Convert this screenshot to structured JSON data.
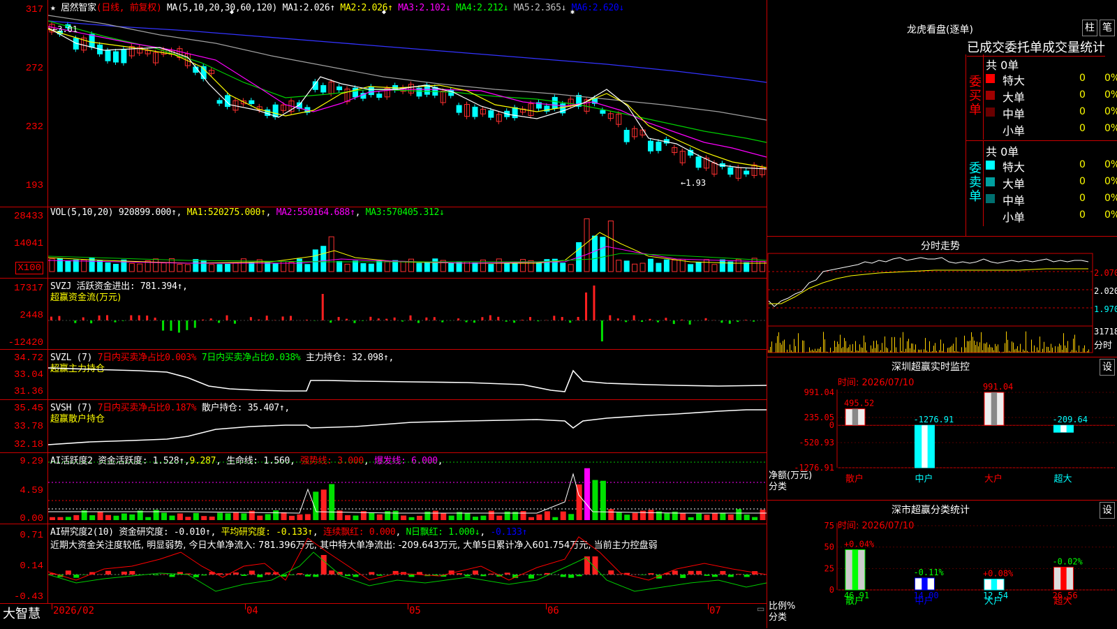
{
  "main": {
    "title": "居然智家",
    "period": "(日线, 前复权)",
    "ma_label": "MA(5,10,20,30,60,120)",
    "ma": [
      {
        "name": "MA1:",
        "value": "2.026↑",
        "color": "#ffffff"
      },
      {
        "name": "MA2:",
        "value": "2.026↑",
        "color": "#ffff00"
      },
      {
        "name": "MA3:",
        "value": "2.102↓",
        "color": "#ff00ff"
      },
      {
        "name": "MA4:",
        "value": "2.212↓",
        "color": "#00ff00"
      },
      {
        "name": "MA5:",
        "value": "2.365↓",
        "color": "#c0c0c0"
      },
      {
        "name": "MA6:",
        "value": "2.620↓",
        "color": "#0000ff"
      }
    ],
    "yticks": [
      "317",
      "272",
      "232",
      "193"
    ],
    "high_label": "3.01",
    "low_label": "1.93"
  },
  "vol": {
    "label": "VOL(5,10,20)",
    "value": "920899.000↑",
    "ma": [
      {
        "name": "MA1:",
        "value": "520275.000↑",
        "color": "#ffff00"
      },
      {
        "name": "MA2:",
        "value": "550164.688↑",
        "color": "#ff00ff"
      },
      {
        "name": "MA3:",
        "value": "570405.312↓",
        "color": "#00ff00"
      }
    ],
    "yticks": [
      "28433",
      "14041"
    ],
    "unit": "X100"
  },
  "svzj": {
    "label": "SVZJ",
    "item": "活跃资金进出:",
    "value": "781.394↑",
    "subtitle": "超赢资金流(万元)",
    "yticks": [
      "17317",
      "2448",
      "-12420"
    ]
  },
  "svzl": {
    "label": "SVZL (7)",
    "t1": "7日内买卖净占比0.003%",
    "t2": "7日内买卖净占比0.038%",
    "t3": "主力持仓:",
    "t3v": "32.098↑",
    "subtitle": "超赢主力持仓",
    "yticks": [
      "34.72",
      "33.04",
      "31.36"
    ]
  },
  "svsh": {
    "label": "SVSH (7)",
    "t1": "7日内买卖净占比0.187%",
    "t3": "散户持仓:",
    "t3v": "35.407↑",
    "subtitle": "超赢散户持仓",
    "yticks": [
      "35.45",
      "33.78",
      "32.18"
    ]
  },
  "ai1": {
    "label": "AI活跃度2",
    "t1": "资金活跃度:",
    "t1v": "1.528↑",
    "t2": "9.287",
    "t3": "生命线:",
    "t3v": "1.560",
    "t4": "强势线:",
    "t4v": "3.000",
    "t5": "爆发线:",
    "t5v": "6.000",
    "yticks": [
      "9.29",
      "4.59",
      "0.00"
    ]
  },
  "ai2": {
    "label": "AI研究度2(10)",
    "t1": "资金研究度:",
    "t1v": "-0.010↑",
    "t2": "平均研究度:",
    "t2v": "-0.133↑",
    "t3": "连续飘红:",
    "t3v": "0.000",
    "t4": "N日飘红:",
    "t4v": "1.000↓",
    "t5": "-0.133↑",
    "comment": "近期大资金关注度较低, 明显弱势, 今日大单净流入: 781.396万元, 其中特大单净流出: -209.643万元, 大单5日累计净入601.754万元, 当前主力控盘弱",
    "yticks": [
      "0.71",
      "0.14",
      "-0.43"
    ]
  },
  "xaxis": {
    "logo": "大智慧",
    "labels": [
      "2026/02",
      "04",
      "05",
      "06",
      "07"
    ]
  },
  "lhb": {
    "title": "龙虎看盘(逐单)",
    "btn1": "柱",
    "btn2": "笔",
    "tabs": "已成交委托单成交量统计",
    "buy_label": "委买单",
    "sell_label": "委卖单",
    "buy_total": "共 0单",
    "sell_total": "共 0单",
    "buy_rows": [
      {
        "name": "特大",
        "color": "#ff0000",
        "num": "0",
        "pct": "0%"
      },
      {
        "name": "大单",
        "color": "#a00000",
        "num": "0",
        "pct": "0%"
      },
      {
        "name": "中单",
        "color": "#6a0000",
        "num": "0",
        "pct": "0%"
      },
      {
        "name": "小单",
        "color": "",
        "num": "0",
        "pct": "0%"
      }
    ],
    "sell_rows": [
      {
        "name": "特大",
        "color": "#00ffff",
        "num": "0",
        "pct": "0%"
      },
      {
        "name": "大单",
        "color": "#00a0a0",
        "num": "0",
        "pct": "0%"
      },
      {
        "name": "中单",
        "color": "#007070",
        "num": "0",
        "pct": "0%"
      },
      {
        "name": "小单",
        "color": "",
        "num": "0",
        "pct": "0%"
      }
    ]
  },
  "fenshi": {
    "title": "分时走势",
    "prices": [
      "2.070",
      "2.020",
      "1.970"
    ],
    "vol": "31718",
    "vol_unit": "分时"
  },
  "monitor": {
    "title": "深圳超赢实时监控",
    "set": "设",
    "time": "时间: 2026/07/10",
    "yticks": [
      "991.04",
      "235.05",
      "0",
      "-520.93",
      "-1276.91"
    ],
    "ylabel": "净额(万元)",
    "xlabel": "分类"
  },
  "classify": {
    "title": "深市超赢分类统计",
    "set": "设",
    "time": "时间: 2026/07/10",
    "yticks": [
      "75",
      "50",
      "25",
      "0"
    ],
    "ylabel": "比例%",
    "xlabel": "分类"
  },
  "chart_data": [
    {
      "type": "bar",
      "title": "深圳超赢实时监控",
      "ylabel": "净额(万元)",
      "xlabel": "分类",
      "categories": [
        "散户",
        "中户",
        "大户",
        "超大"
      ],
      "values": [
        495.52,
        -1276.91,
        991.04,
        -209.64
      ],
      "ylim": [
        -1276.91,
        991.04
      ]
    },
    {
      "type": "bar",
      "title": "深市超赢分类统计",
      "ylabel": "比例%",
      "xlabel": "分类",
      "categories": [
        "散户",
        "中户",
        "大户",
        "超大"
      ],
      "values": [
        46.91,
        14.0,
        12.54,
        26.56
      ],
      "changes": [
        "+0.04%",
        "-0.11%",
        "+0.08%",
        "-0.02%"
      ],
      "ylim": [
        0,
        75
      ]
    }
  ]
}
